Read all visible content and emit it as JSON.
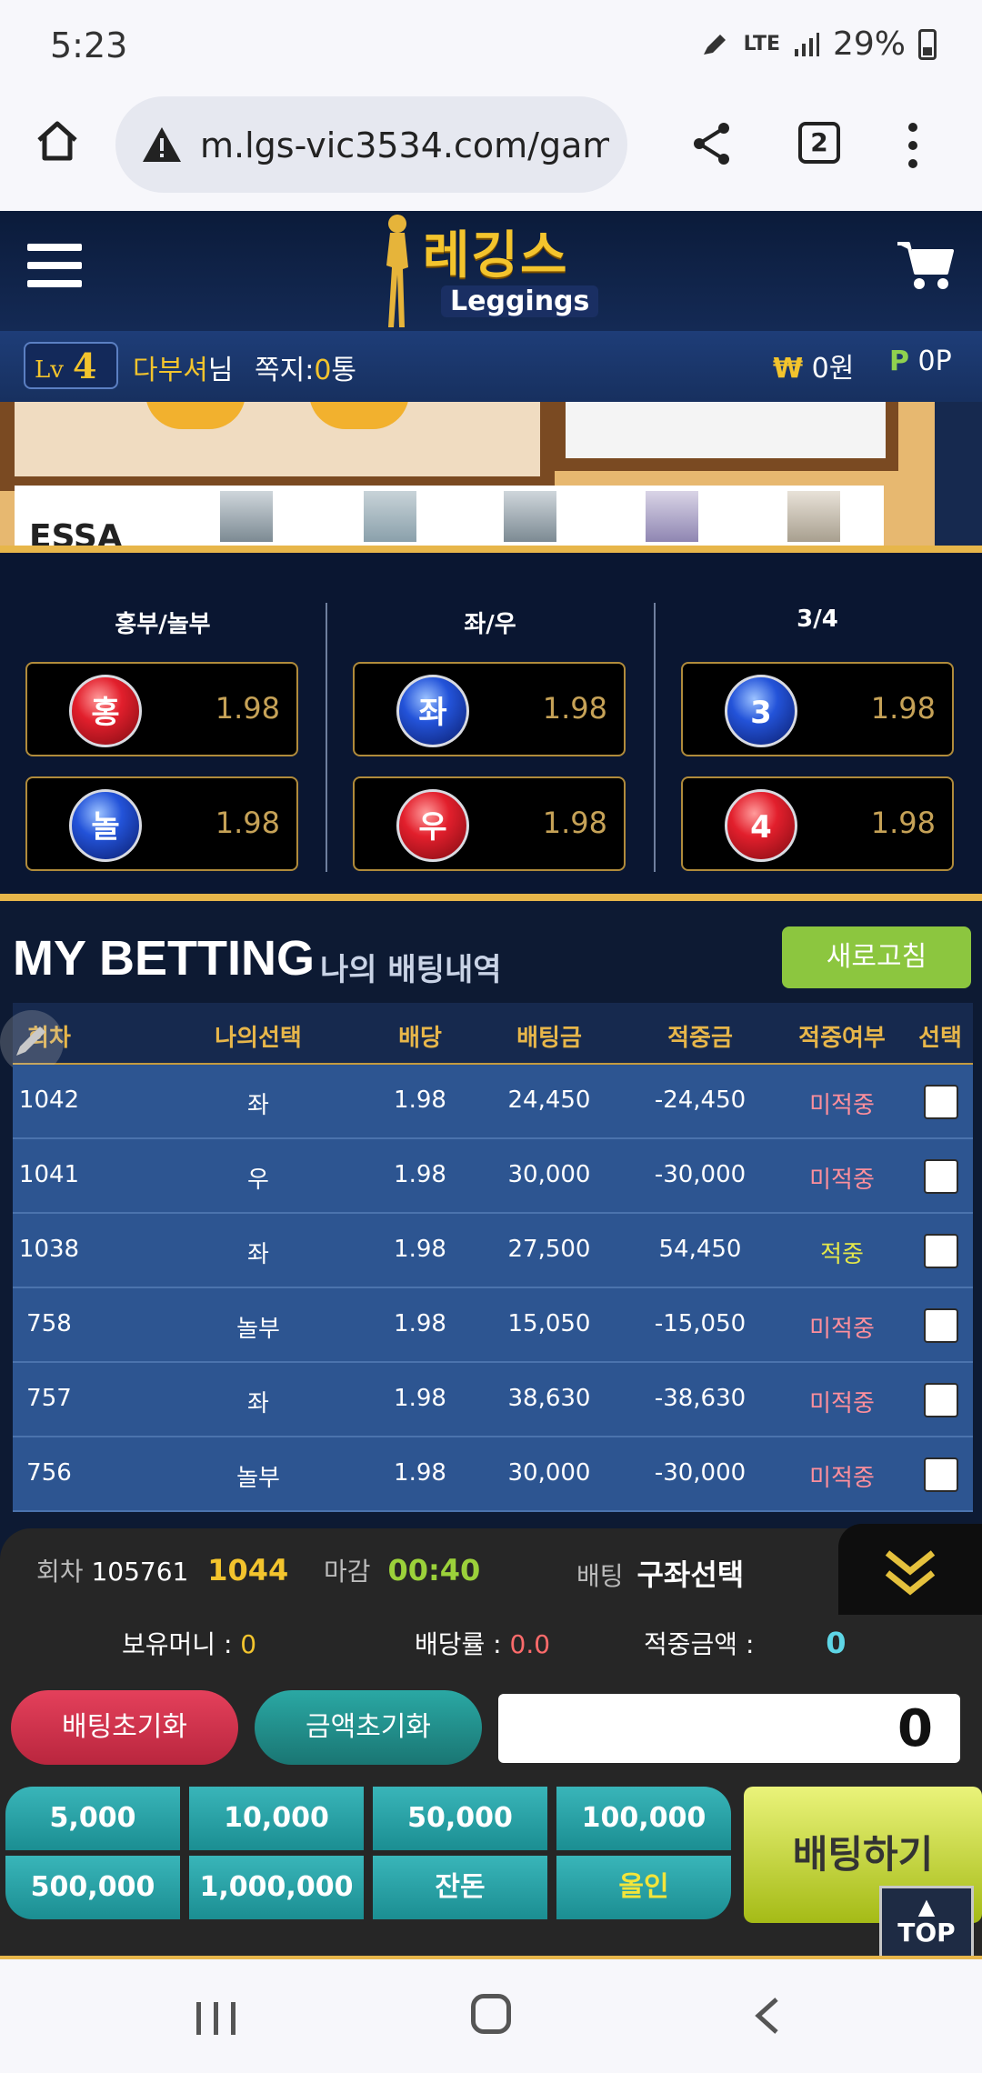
{
  "status_bar": {
    "time": "5:23",
    "network": "LTE",
    "battery": "29%"
  },
  "browser": {
    "url": "m.lgs-vic3534.com/gam",
    "tab_count": "2"
  },
  "site": {
    "logo_ko": "레깅스",
    "logo_en": "Leggings"
  },
  "user": {
    "level_prefix": "Lv",
    "level": "4",
    "name": "다부셔",
    "name_suffix": "님",
    "messages_label": "쪽지:",
    "messages_count": "0",
    "messages_unit": "통",
    "money_symbol": "₩",
    "money": "0원",
    "points_symbol": "P",
    "points": "0P"
  },
  "banner": {
    "text": "ESSA"
  },
  "bet_columns": [
    {
      "title": "홍부/놀부",
      "options": [
        {
          "label": "홍",
          "odds": "1.98",
          "color": "red"
        },
        {
          "label": "놀",
          "odds": "1.98",
          "color": "blue"
        }
      ]
    },
    {
      "title": "좌/우",
      "options": [
        {
          "label": "좌",
          "odds": "1.98",
          "color": "blue"
        },
        {
          "label": "우",
          "odds": "1.98",
          "color": "red"
        }
      ]
    },
    {
      "title": "3/4",
      "options": [
        {
          "label": "3",
          "odds": "1.98",
          "color": "blue"
        },
        {
          "label": "4",
          "odds": "1.98",
          "color": "red"
        }
      ]
    }
  ],
  "my_betting": {
    "title": "MY BETTING",
    "subtitle": "나의 배팅내역",
    "refresh_label": "새로고침",
    "columns": [
      "회차",
      "나의선택",
      "배당",
      "배팅금",
      "적중금",
      "적중여부",
      "선택"
    ],
    "rows": [
      {
        "round": "1042",
        "choice": "좌",
        "odds": "1.98",
        "bet": "24,450",
        "payout": "-24,450",
        "result": "미적중",
        "hit": false
      },
      {
        "round": "1041",
        "choice": "우",
        "odds": "1.98",
        "bet": "30,000",
        "payout": "-30,000",
        "result": "미적중",
        "hit": false
      },
      {
        "round": "1038",
        "choice": "좌",
        "odds": "1.98",
        "bet": "27,500",
        "payout": "54,450",
        "result": "적중",
        "hit": true
      },
      {
        "round": "758",
        "choice": "놀부",
        "odds": "1.98",
        "bet": "15,050",
        "payout": "-15,050",
        "result": "미적중",
        "hit": false
      },
      {
        "round": "757",
        "choice": "좌",
        "odds": "1.98",
        "bet": "38,630",
        "payout": "-38,630",
        "result": "미적중",
        "hit": false
      },
      {
        "round": "756",
        "choice": "놀부",
        "odds": "1.98",
        "bet": "30,000",
        "payout": "-30,000",
        "result": "미적중",
        "hit": false
      }
    ]
  },
  "bet_form": {
    "round_label": "회차",
    "round_full": "105761",
    "round_short": "1044",
    "close_label": "마감",
    "close_time": "00:40",
    "bet_label": "배팅",
    "bet_choice": "구좌선택",
    "balance_label": "보유머니 :",
    "balance_value": "0",
    "odds_label": "배당률 :",
    "odds_value": "0.0",
    "win_label": "적중금액 :",
    "win_value": "0",
    "reset_bet_label": "배팅초기화",
    "reset_amount_label": "금액초기화",
    "amount_value": "0",
    "chips": [
      "5,000",
      "10,000",
      "50,000",
      "100,000",
      "500,000",
      "1,000,000",
      "잔돈",
      "올인"
    ],
    "submit_label": "배팅하기",
    "top_label": "TOP"
  }
}
